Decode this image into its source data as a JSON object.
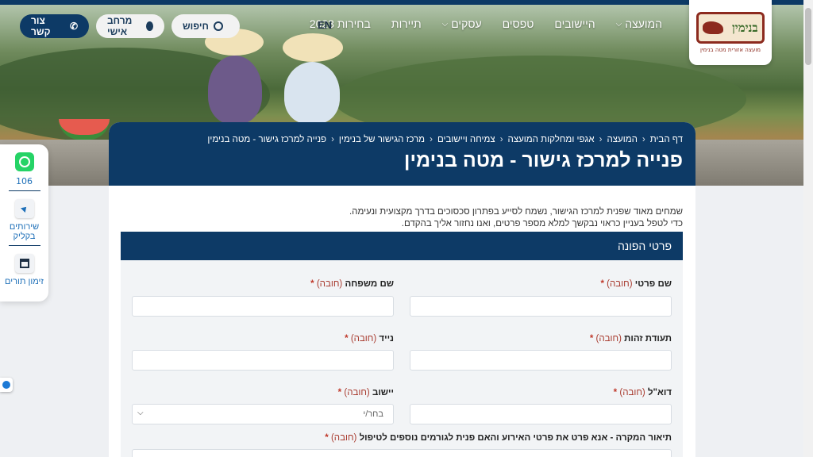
{
  "header": {
    "nav_items": [
      {
        "label": "המועצה",
        "has_dropdown": true
      },
      {
        "label": "היישובים",
        "has_dropdown": false
      },
      {
        "label": "טפסים",
        "has_dropdown": false
      },
      {
        "label": "עסקים",
        "has_dropdown": true
      },
      {
        "label": "תיירות",
        "has_dropdown": false
      },
      {
        "label": "בחירות 2023",
        "has_dropdown": false
      }
    ],
    "lang": "EN",
    "search_label": "חיפוש",
    "personal_label": "מרחב אישי",
    "contact_label": "צור קשר",
    "logo": {
      "name": "בנימין",
      "tagline": "מועצה אזורית מטה בנימין"
    }
  },
  "side_widget": {
    "count": "106",
    "services_label": "שירותים בקליק",
    "appointments_label": "זימון תורים"
  },
  "page": {
    "breadcrumbs": [
      "דף הבית",
      "המועצה",
      "אגפי ומחלקות המועצה",
      "צמיחה ויישובים",
      "מרכז הגישור של בנימין",
      "פנייה למרכז גישור - מטה בנימין"
    ],
    "title": "פנייה למרכז גישור - מטה בנימין",
    "intro_line1": "שמחים מאוד שפנית למרכז הגישור, נשמח לסייע בפתרון סכסוכים בדרך מקצועית ונעימה.",
    "intro_line2": "כדי לטפל בעניין כראוי נבקשך למלא מספר פרטים, ואנו נחזור אליך בהקדם."
  },
  "form": {
    "panel_title": "פרטי הפונה",
    "required_text": "(חובה)",
    "fields": {
      "first_name": "שם פרטי",
      "last_name": "שם משפחה",
      "id_number": "תעודת זהות",
      "mobile": "נייד",
      "email": "דוא\"ל",
      "settlement": "יישוב",
      "description": "תיאור המקרה - אנא פרט את פרטי האירוע והאם פנית לגורמים נוספים לטיפול"
    },
    "settlement_placeholder": "בחר/י"
  },
  "colors": {
    "brand_navy": "#0d3a66",
    "required_red": "#c0392b",
    "link_blue": "#1d6fb8"
  }
}
